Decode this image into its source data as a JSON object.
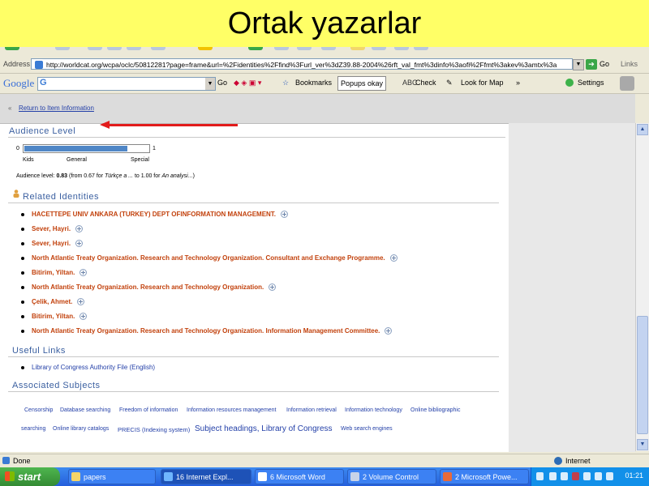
{
  "slide": {
    "title": "Ortak yazarlar"
  },
  "browser": {
    "address_label": "Address",
    "url": "http://worldcat.org/wcpa/oclc/50812281?page=frame&url=%2Fidentities%2Ffind%3Furl_ver%3dZ39.88-2004%26rft_val_fmt%3dinfo%3aofi%2Ffmt%3akev%3amtx%3a",
    "go_label": "Go",
    "links_label": "Links",
    "google_logo": "Google",
    "google_search_glyph": "G",
    "google_go": "Go",
    "bookmarks_label": "Bookmarks",
    "popups_label": "Popups okay",
    "check_label": "Check",
    "look_for_map_label": "Look for Map",
    "more_label": "»",
    "settings_label": "Settings",
    "status_text": "Done",
    "zone_text": "Internet"
  },
  "page": {
    "return_arrows": "«",
    "return_link": "Return to Item Information",
    "audience": {
      "heading": "Audience Level",
      "level": 0.83,
      "scale_min": "0",
      "scale_max": "1",
      "label_kids": "Kids",
      "label_general": "General",
      "label_special": "Special",
      "summary_prefix": "Audience level:",
      "summary_value": "0.83",
      "summary_from": "(from 0.67 for",
      "summary_title1": "Türkçe a ...",
      "summary_to": "to 1.00 for",
      "summary_title2": "An analysi...",
      "summary_end": ")"
    },
    "related": {
      "heading": "Related Identities",
      "items": [
        "HACETTEPE UNIV ANKARA (TURKEY) DEPT OFINFORMATION MANAGEMENT.",
        "Sever, Hayri.",
        "Sever, Hayri.",
        "North Atlantic Treaty Organization. Research and Technology Organization. Consultant and Exchange Programme.",
        "Bitirim, Yiltan.",
        "North Atlantic Treaty Organization. Research and Technology Organization.",
        "Çelik, Ahmet.",
        "Bitirim, Yiltan.",
        "North Atlantic Treaty Organization. Research and Technology Organization. Information Management Committee."
      ]
    },
    "useful_links": {
      "heading": "Useful Links",
      "items": [
        "Library of Congress Authority File (English)"
      ]
    },
    "subjects": {
      "heading": "Associated Subjects",
      "row1": [
        "Censorship",
        "Database searching",
        "Freedom of information",
        "Information resources management",
        "Information retrieval",
        "Information technology",
        "Online bibliographic"
      ],
      "row2": [
        "searching",
        "Online library catalogs",
        "PRECIS (Indexing system)",
        "Subject headings, Library of Congress",
        "Web search engines"
      ]
    }
  },
  "taskbar": {
    "start_label": "start",
    "tasks": [
      {
        "label": "papers"
      },
      {
        "label": "16 Internet Expl..."
      },
      {
        "label": "6 Microsoft Word"
      },
      {
        "label": "2 Volume Control"
      },
      {
        "label": "2 Microsoft Powe..."
      }
    ],
    "clock": "01:21"
  }
}
